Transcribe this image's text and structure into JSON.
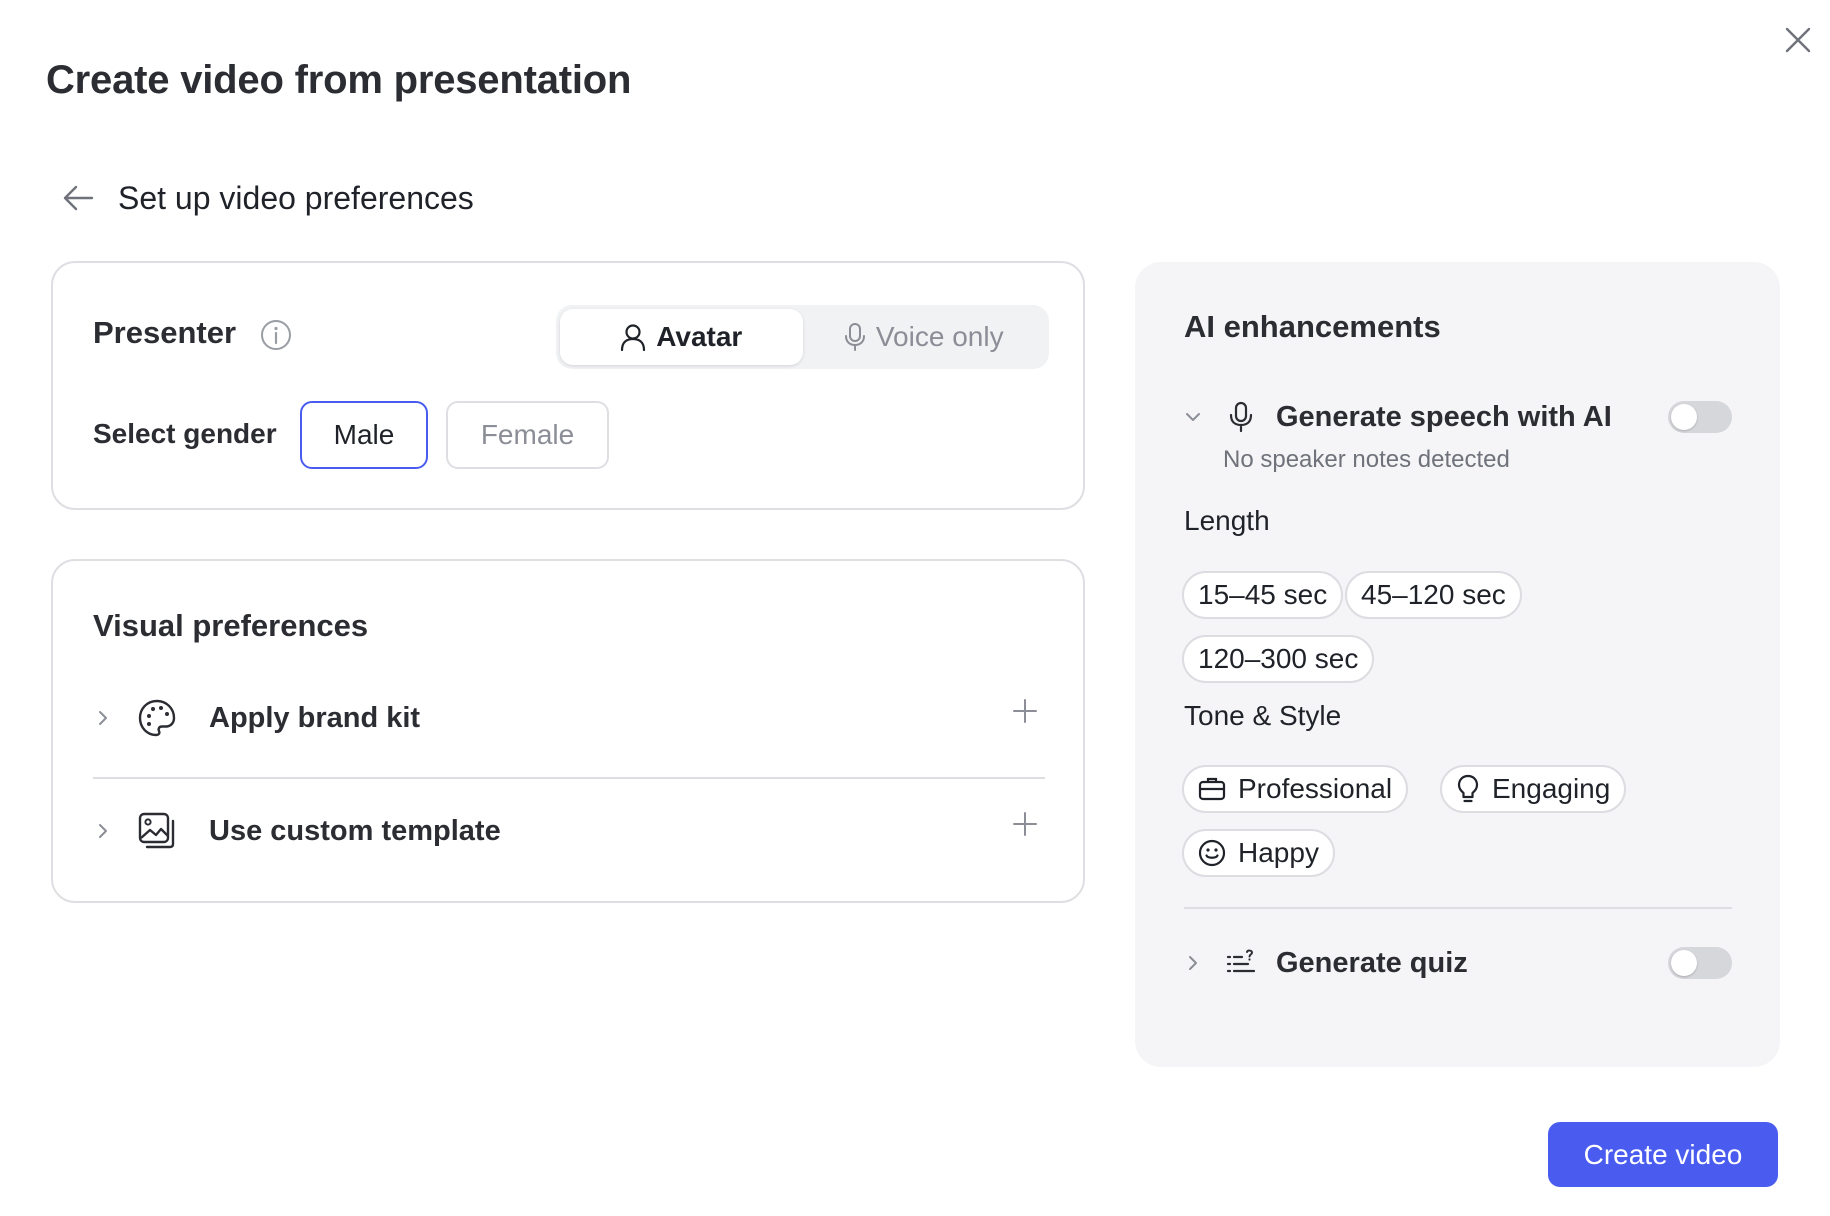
{
  "dialog": {
    "title": "Create video from presentation",
    "close_icon": "close-icon"
  },
  "step": {
    "back_icon": "arrow-left-icon",
    "label": "Set up video preferences"
  },
  "presenter": {
    "title": "Presenter",
    "info_icon": "info-icon",
    "mode_options": [
      {
        "label": "Avatar",
        "icon": "person-icon",
        "selected": true
      },
      {
        "label": "Voice only",
        "icon": "microphone-icon",
        "selected": false
      }
    ],
    "gender_label": "Select gender",
    "gender_options": [
      {
        "label": "Male",
        "selected": true
      },
      {
        "label": "Female",
        "selected": false
      }
    ]
  },
  "visual": {
    "title": "Visual preferences",
    "rows": [
      {
        "label": "Apply brand kit",
        "icon": "palette-icon"
      },
      {
        "label": "Use custom template",
        "icon": "image-template-icon"
      }
    ]
  },
  "ai": {
    "title": "AI enhancements",
    "speech": {
      "label": "Generate speech with AI",
      "icon": "microphone-icon",
      "subtext": "No speaker notes detected",
      "enabled": false
    },
    "length_label": "Length",
    "length_options": [
      "15–45 sec",
      "45–120 sec",
      "120–300 sec"
    ],
    "tone_label": "Tone & Style",
    "tone_options": [
      {
        "label": "Professional",
        "icon": "briefcase-icon"
      },
      {
        "label": "Engaging",
        "icon": "lightbulb-icon"
      },
      {
        "label": "Happy",
        "icon": "smiley-icon"
      }
    ],
    "quiz": {
      "label": "Generate quiz",
      "icon": "quiz-list-icon",
      "enabled": false
    }
  },
  "footer": {
    "create_label": "Create video"
  },
  "colors": {
    "accent": "#4a5cf0",
    "panel_bg": "#f5f5f7",
    "border": "#dedfe3"
  }
}
